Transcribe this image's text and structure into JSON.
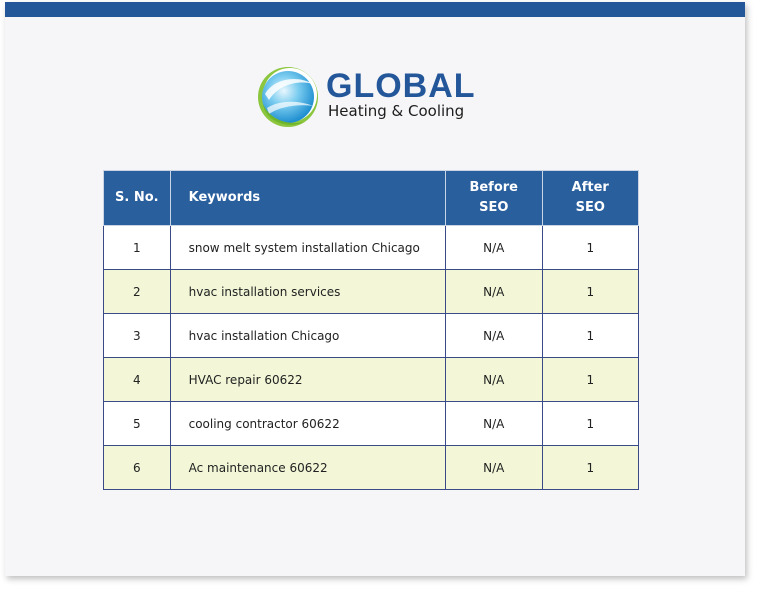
{
  "brand": {
    "name": "GLOBAL",
    "tagline": "Heating & Cooling",
    "colors": {
      "primary": "#23579a",
      "accent_green": "#8cc63f",
      "accent_sky": "#35a8e0",
      "row_tint": "#f3f7d7"
    }
  },
  "table": {
    "headers": {
      "sno": "S. No.",
      "keywords": "Keywords",
      "before_line1": "Before",
      "before_line2": "SEO",
      "after_line1": "After",
      "after_line2": "SEO"
    },
    "rows": [
      {
        "sno": "1",
        "keyword": "snow melt system installation Chicago",
        "before": "N/A",
        "after": "1"
      },
      {
        "sno": "2",
        "keyword": "hvac installation services",
        "before": "N/A",
        "after": "1"
      },
      {
        "sno": "3",
        "keyword": "hvac installation Chicago",
        "before": "N/A",
        "after": "1"
      },
      {
        "sno": "4",
        "keyword": "HVAC repair 60622",
        "before": "N/A",
        "after": "1"
      },
      {
        "sno": "5",
        "keyword": "cooling contractor 60622",
        "before": "N/A",
        "after": "1"
      },
      {
        "sno": "6",
        "keyword": "Ac maintenance 60622",
        "before": "N/A",
        "after": "1"
      }
    ]
  }
}
